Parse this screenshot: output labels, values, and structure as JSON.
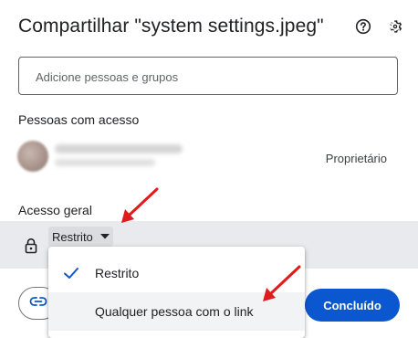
{
  "dialog": {
    "title": "Compartilhar \"system settings.jpeg\"",
    "header_icons": [
      "help-icon",
      "gear-icon"
    ]
  },
  "add_people": {
    "placeholder": "Adicione pessoas e grupos"
  },
  "people_with_access": {
    "label": "Pessoas com acesso",
    "entries": [
      {
        "role": "Proprietário",
        "avatar_icon": "avatar"
      }
    ]
  },
  "general_access": {
    "label": "Acesso geral",
    "selected": "Restrito",
    "icon": "lock-icon"
  },
  "access_menu": {
    "items": [
      {
        "label": "Restrito",
        "checked": true
      },
      {
        "label": "Qualquer pessoa com o link",
        "checked": false
      }
    ]
  },
  "footer": {
    "copy_link_icon": "link-icon",
    "done_label": "Concluído"
  },
  "colors": {
    "primary": "#0b57d0",
    "annotation_arrow": "#e01b1b",
    "access_row_bg": "#e8eaed"
  }
}
